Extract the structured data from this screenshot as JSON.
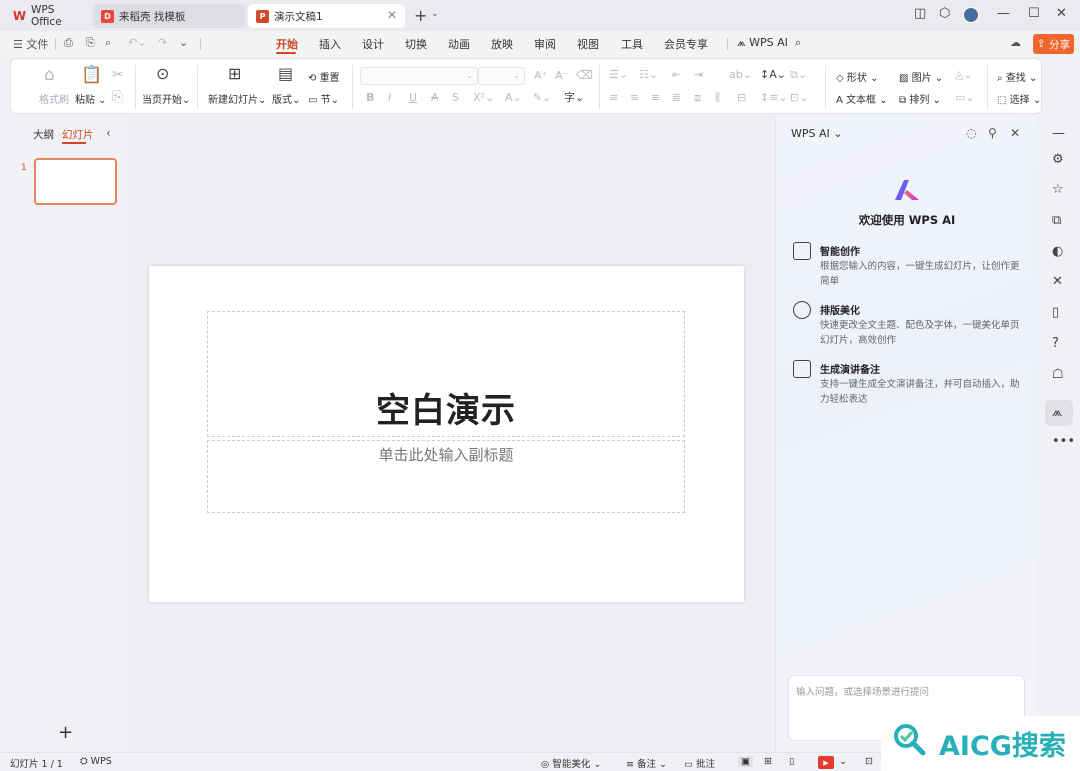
{
  "tabs": {
    "wps": "WPS Office",
    "daoke": "来稻壳 找模板",
    "doc": "演示文稿1"
  },
  "menubar": {
    "file": "文件",
    "items": [
      "开始",
      "插入",
      "设计",
      "切换",
      "动画",
      "放映",
      "审阅",
      "视图",
      "工具",
      "会员专享"
    ],
    "wps_ai": "WPS AI",
    "share": "分享"
  },
  "ribbon": {
    "format_painter": "格式刷",
    "paste": "粘贴",
    "from_current": "当页开始",
    "new_slide": "新建幻灯片",
    "layout": "版式",
    "reset": "重置",
    "section": "节",
    "shape": "形状",
    "picture": "图片",
    "textbox": "文本框",
    "arrange": "排列",
    "find": "查找",
    "select": "选择"
  },
  "left_panel": {
    "outline": "大纲",
    "slides": "幻灯片",
    "slide_number": "1"
  },
  "slide": {
    "title": "空白演示",
    "subtitle": "单击此处输入副标题"
  },
  "ai_panel": {
    "header": "WPS AI",
    "welcome": "欢迎使用 WPS AI",
    "features": [
      {
        "title": "智能创作",
        "desc": "根据您输入的内容，一键生成幻灯片，让创作更简单"
      },
      {
        "title": "排版美化",
        "desc": "快速更改全文主题、配色及字体，一键美化单页幻灯片，高效创作"
      },
      {
        "title": "生成演讲备注",
        "desc": "支持一键生成全文演讲备注，并可自动插入，助力轻松表达"
      }
    ],
    "input_placeholder": "输入问题，或选择场景进行提问"
  },
  "statusbar": {
    "slide_count": "幻灯片 1 / 1",
    "theme": "WPS",
    "smart_beautify": "智能美化",
    "notes": "备注",
    "comments": "批注"
  },
  "watermark": "AICG搜索",
  "colors": {
    "accent": "#d24726",
    "share": "#f1662e",
    "watermark": "#27b0b8"
  }
}
